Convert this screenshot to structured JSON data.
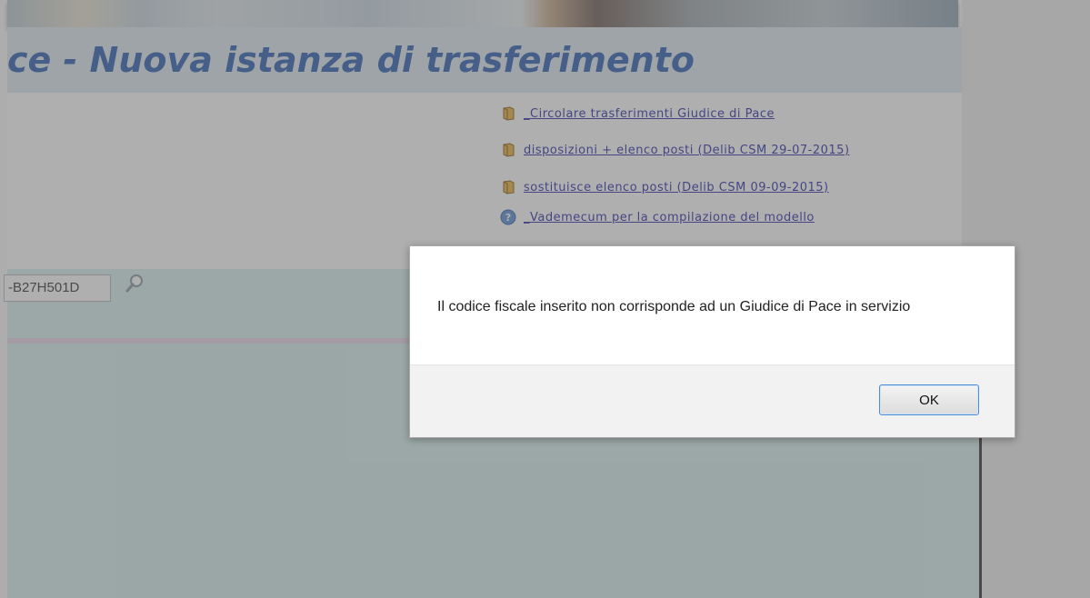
{
  "page": {
    "title": "ce - Nuova istanza di trasferimento"
  },
  "links": [
    {
      "icon": "book-icon",
      "label": "_Circolare trasferimenti Giudice di Pace"
    },
    {
      "icon": "book-icon",
      "label": "disposizioni + elenco posti (Delib CSM 29-07-2015)"
    },
    {
      "icon": "book-icon",
      "label": "sostituisce elenco posti (Delib CSM 09-09-2015)"
    },
    {
      "icon": "help-icon",
      "label": "_Vademecum per la compilazione del modello"
    }
  ],
  "form": {
    "codice_fiscale_value": "-B27H501D"
  },
  "dialog": {
    "message": "Il codice fiscale inserito non corrisponde ad un Giudice di Pace in servizio",
    "ok_label": "OK"
  },
  "colors": {
    "title": "#2c5fb0",
    "link": "#2a2aa6",
    "panel": "#d8f0ef",
    "ok_border": "#4a90d9"
  }
}
